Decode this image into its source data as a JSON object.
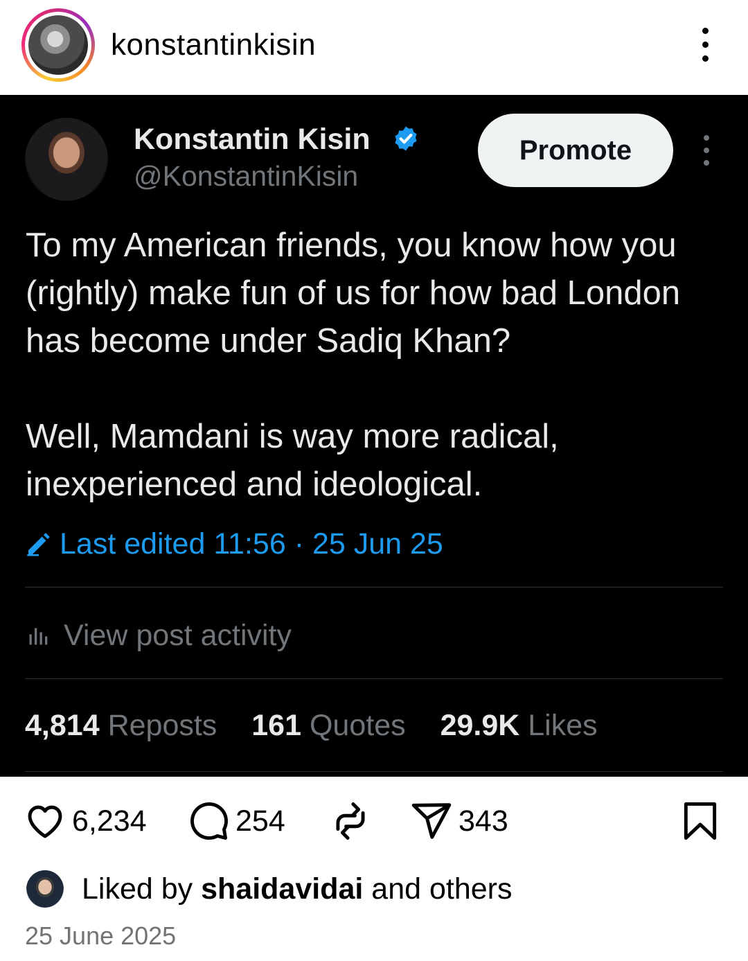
{
  "instagram": {
    "username": "konstantinkisin",
    "likes_count": "6,234",
    "comments_count": "254",
    "shares_count": "343",
    "liked_by_prefix": "Liked by ",
    "liked_by_user": "shaidavidai",
    "liked_by_suffix": " and others",
    "date": "25 June 2025",
    "icons": [
      "heart-icon",
      "comment-icon",
      "repost-icon",
      "send-icon",
      "bookmark-icon",
      "more-icon"
    ]
  },
  "tweet": {
    "display_name": "Konstantin Kisin",
    "handle": "@KonstantinKisin",
    "promote_label": "Promote",
    "text_para1": "To my American friends, you know how you (rightly) make fun of us for how bad London has become under Sadiq Khan?",
    "text_para2": "Well, Mamdani is way more radical, inexperienced and ideological.",
    "edited_label": "Last edited 11:56 · 25 Jun 25",
    "activity_label": "View post activity",
    "reposts_count": "4,814",
    "reposts_label": "Reposts",
    "quotes_count": "161",
    "quotes_label": "Quotes",
    "likes_count": "29.9K",
    "likes_label": "Likes",
    "accent_color": "#1d9bf0",
    "verified": true
  }
}
